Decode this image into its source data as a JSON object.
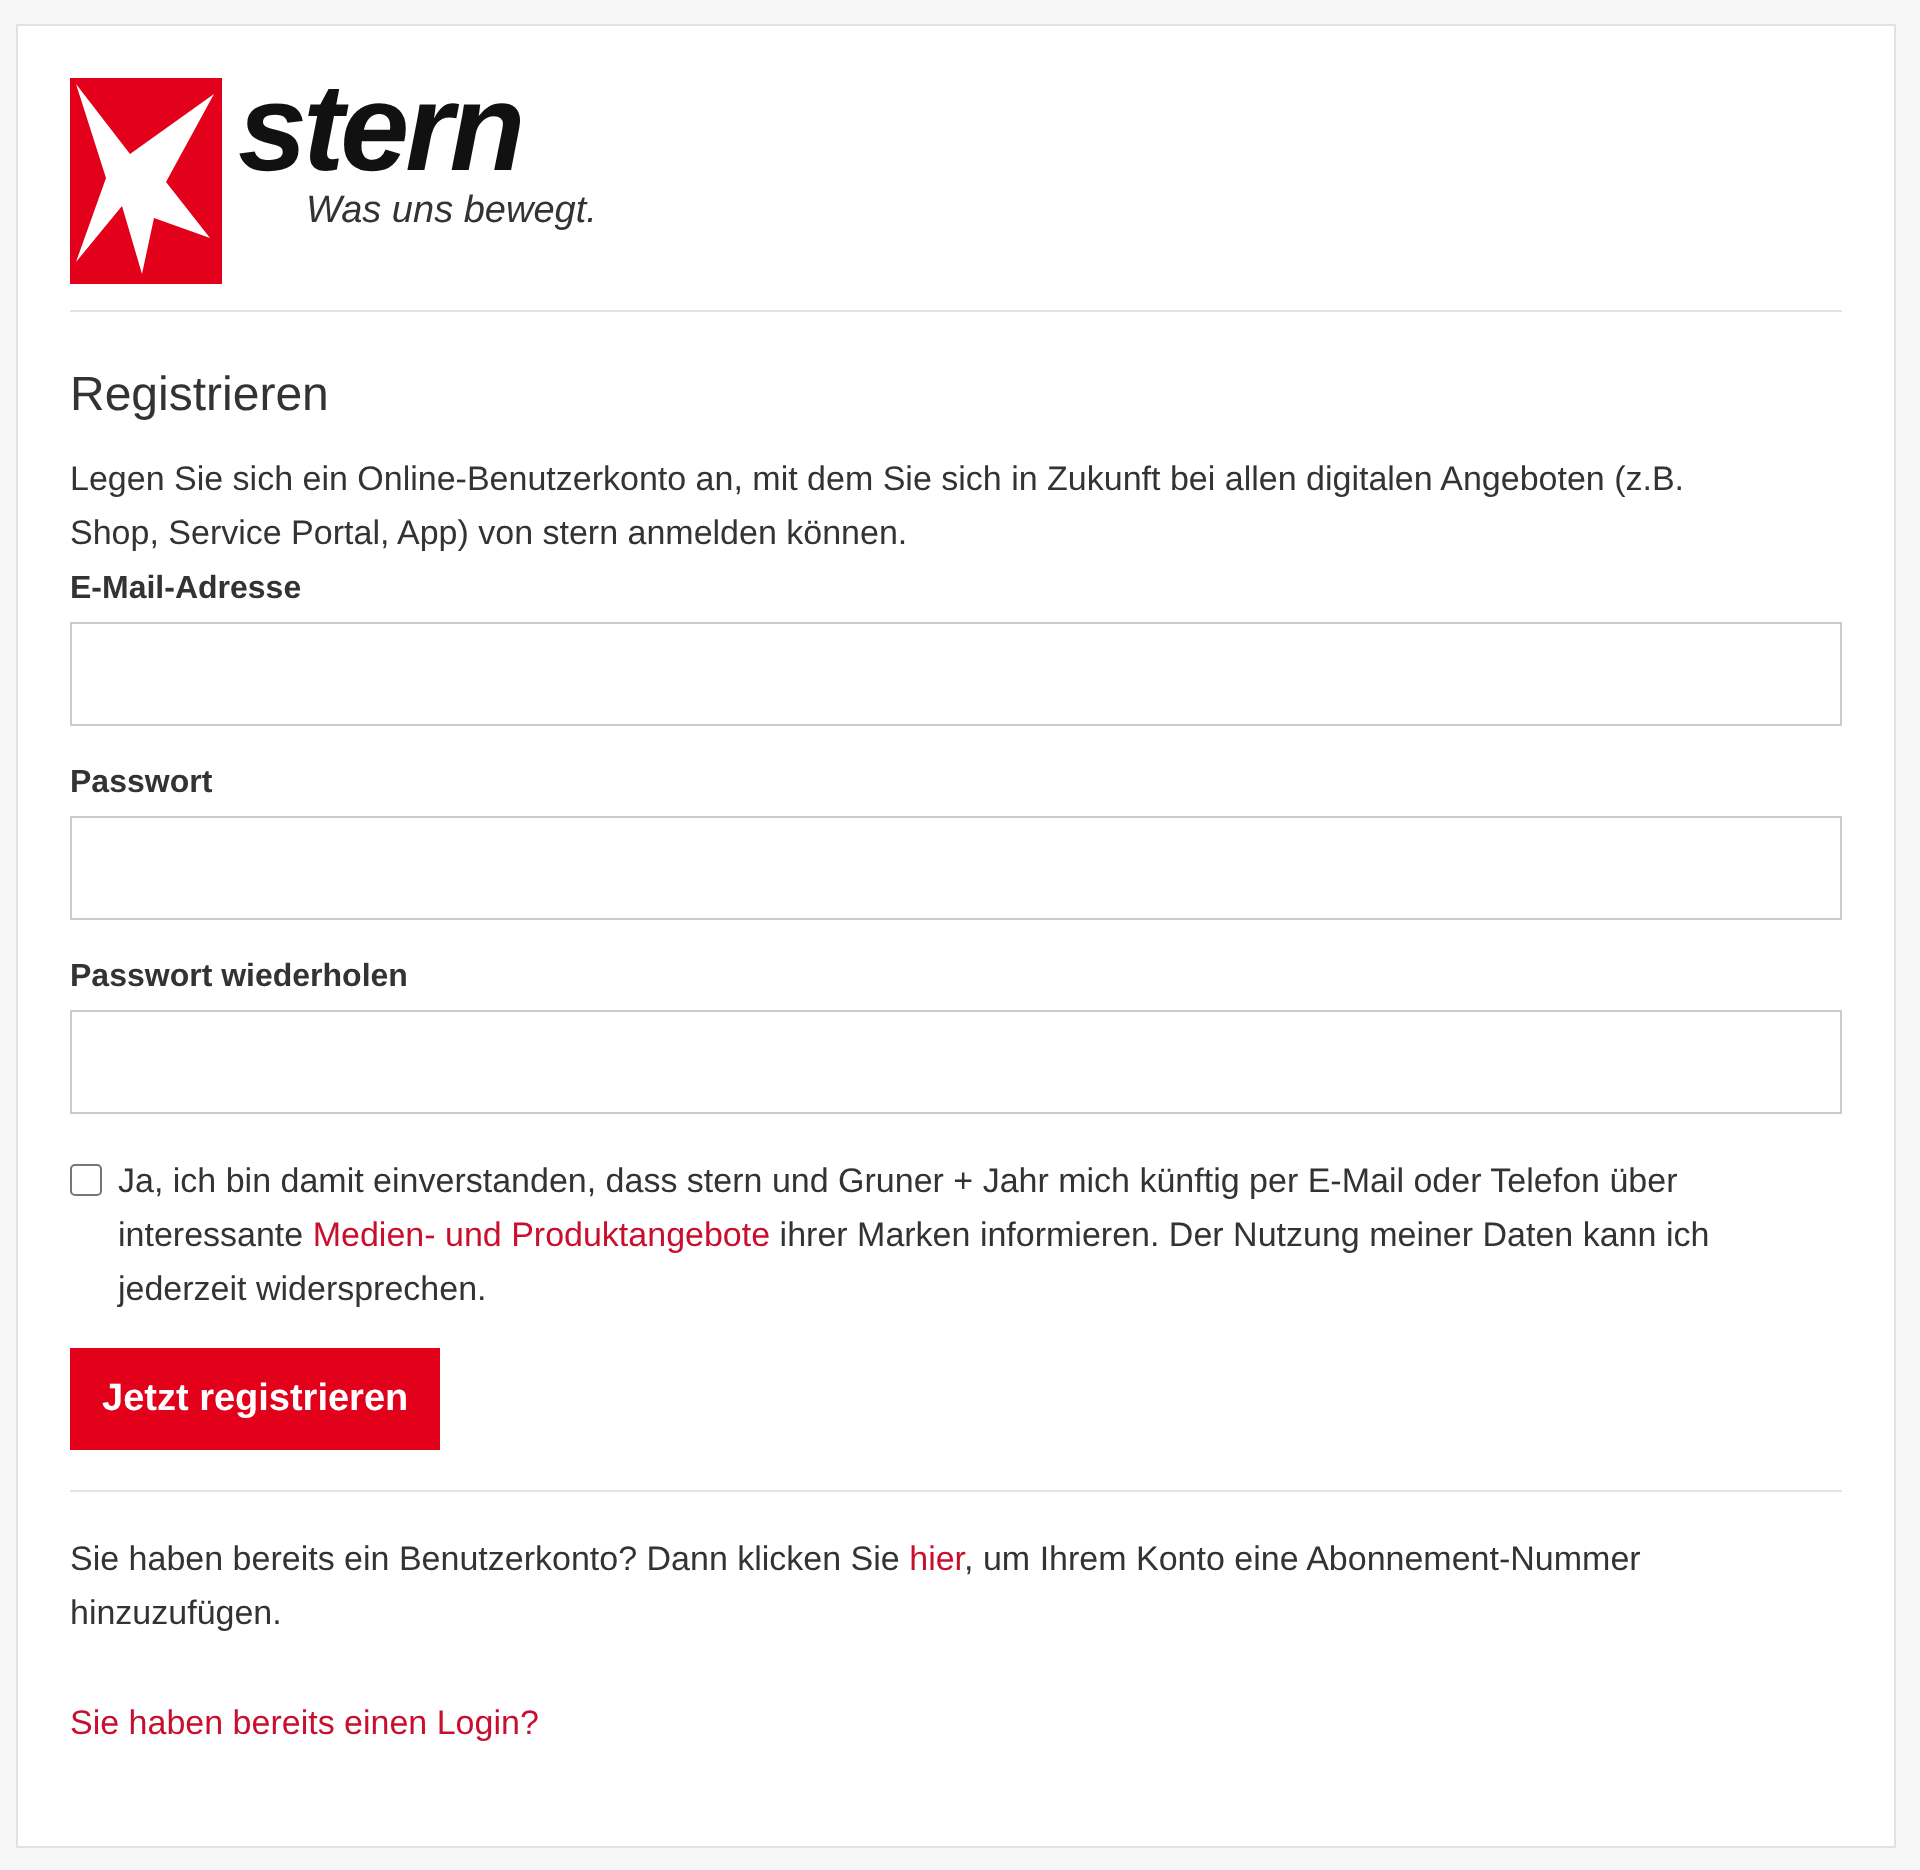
{
  "logo": {
    "wordmark": "stern",
    "tagline": "Was uns bewegt."
  },
  "heading": "Registrieren",
  "intro": "Legen Sie sich ein Online-Benutzerkonto an, mit dem Sie sich in Zukunft bei allen digitalen Angeboten (z.B. Shop, Service Portal, App) von stern anmelden können.",
  "fields": [
    {
      "label": "E-Mail-Adresse"
    },
    {
      "label": "Passwort"
    },
    {
      "label": "Passwort wiederholen"
    }
  ],
  "consent": {
    "checked": false,
    "parts": [
      {
        "kind": "text",
        "text": "Ja, ich bin damit einverstanden, dass stern und Gruner + Jahr mich künftig per E-Mail oder Telefon über interessante "
      },
      {
        "kind": "link",
        "text": "Medien- und Produktangebote"
      },
      {
        "kind": "text",
        "text": " ihrer Marken informieren. Der Nutzung meiner Daten kann ich jederzeit widersprechen."
      }
    ]
  },
  "submit": "Jetzt registrieren",
  "account_note": [
    {
      "kind": "text",
      "text": "Sie haben bereits ein Benutzerkonto? Dann klicken Sie "
    },
    {
      "kind": "link",
      "text": "hier"
    },
    {
      "kind": "text",
      "text": ", um Ihrem Konto eine Abonnement-Nummer hinzuzufügen."
    }
  ],
  "login_link": "Sie haben bereits einen Login?"
}
